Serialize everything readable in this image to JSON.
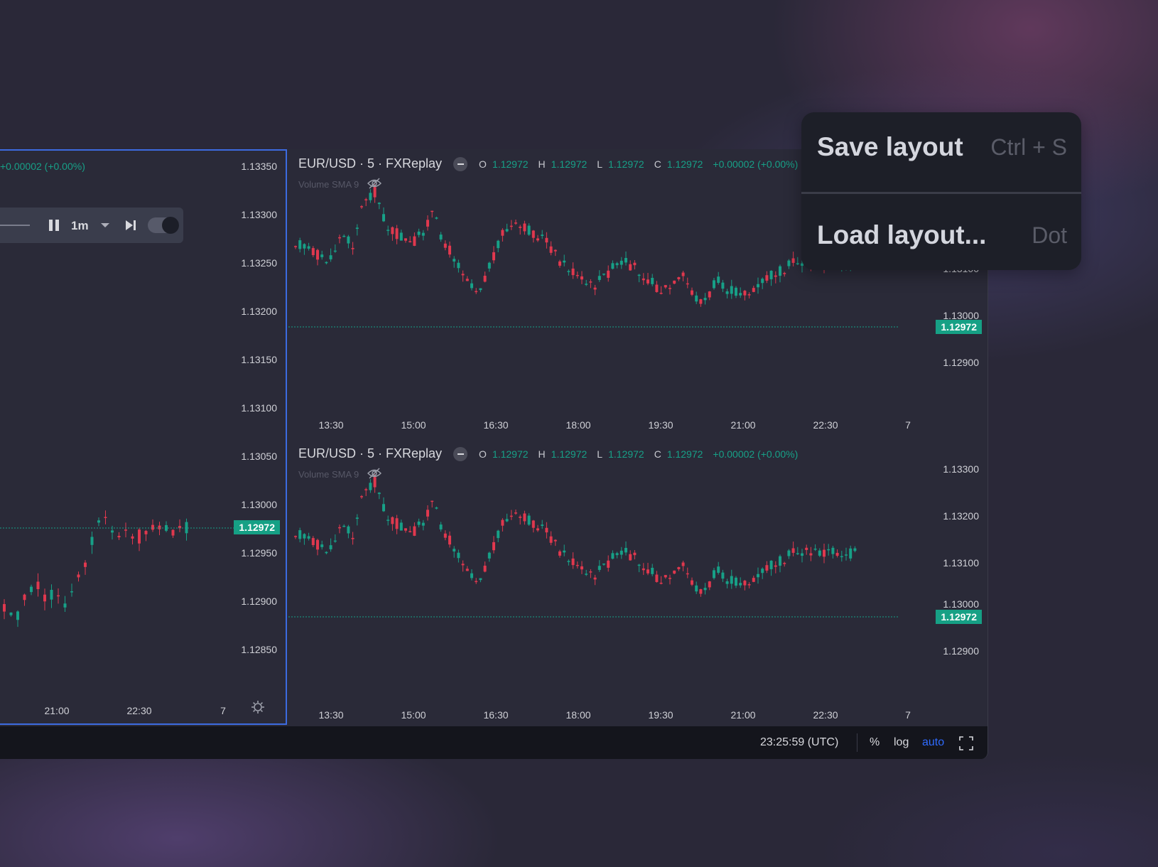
{
  "left_panel": {
    "change_text": "+0.00002 (+0.00%)",
    "price_ticks": [
      "1.13350",
      "1.13300",
      "1.13250",
      "1.13200",
      "1.13150",
      "1.13100",
      "1.13050",
      "1.13000",
      "1.12950",
      "1.12900",
      "1.12850"
    ],
    "time_ticks": [
      "21:00",
      "22:30",
      "7"
    ],
    "last_price": "1.12972",
    "replay": {
      "speed": "1m"
    }
  },
  "chart_top": {
    "symbol": "EUR/USD · 5 · FXReplay",
    "ohlc": {
      "o_label": "O",
      "o": "1.12972",
      "h_label": "H",
      "h": "1.12972",
      "l_label": "L",
      "l": "1.12972",
      "c_label": "C",
      "c": "1.12972",
      "change": "+0.00002 (+0.00%)"
    },
    "indicator": "Volume SMA 9",
    "price_ticks": [
      "1.13100",
      "1.13000",
      "1.12900"
    ],
    "last_price": "1.12972",
    "time_ticks": [
      "13:30",
      "15:00",
      "16:30",
      "18:00",
      "19:30",
      "21:00",
      "22:30",
      "7"
    ]
  },
  "chart_bottom": {
    "symbol": "EUR/USD · 5 · FXReplay",
    "ohlc": {
      "o_label": "O",
      "o": "1.12972",
      "h_label": "H",
      "h": "1.12972",
      "l_label": "L",
      "l": "1.12972",
      "c_label": "C",
      "c": "1.12972",
      "change": "+0.00002 (+0.00%)"
    },
    "indicator": "Volume SMA 9",
    "price_ticks": [
      "1.13300",
      "1.13200",
      "1.13100",
      "1.13000",
      "1.12900"
    ],
    "last_price": "1.12972",
    "time_ticks": [
      "13:30",
      "15:00",
      "16:30",
      "18:00",
      "19:30",
      "21:00",
      "22:30",
      "7"
    ]
  },
  "bottom_bar": {
    "time": "23:25:59 (UTC)",
    "percent": "%",
    "log": "log",
    "auto": "auto"
  },
  "menu": {
    "save_label": "Save layout",
    "save_shortcut": "Ctrl + S",
    "load_label": "Load layout...",
    "load_shortcut": "Dot"
  },
  "colors": {
    "up": "#17a087",
    "down": "#e0384e",
    "accent": "#2f6bff",
    "tag": "#16a085"
  }
}
